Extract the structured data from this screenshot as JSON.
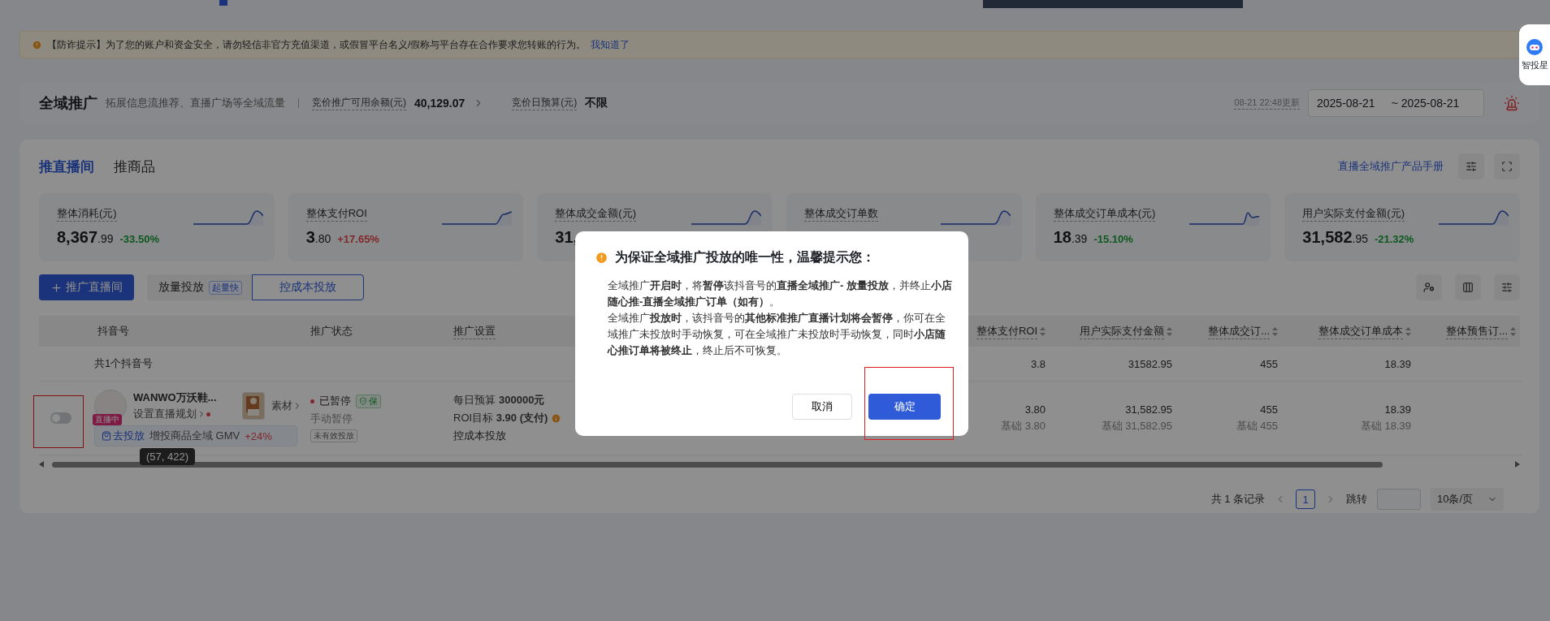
{
  "notice": {
    "text": "【防诈提示】为了您的账户和资金安全，请勿轻信非官方充值渠道，或假冒平台名义/假称与平台存在合作要求您转账的行为。",
    "link": "我知道了"
  },
  "assistant": {
    "label": "智投星"
  },
  "header": {
    "title": "全域推广",
    "subtitle": "拓展信息流推荐、直播广场等全域流量",
    "balance_label": "竞价推广可用余额(元)",
    "balance": "40,129.07",
    "budget_label": "竞价日预算(元)",
    "budget": "不限",
    "updated": "08-21 22:48更新",
    "date_start": "2025-08-21",
    "date_end": "~ 2025-08-21"
  },
  "tabs": [
    {
      "label": "推直播间",
      "selected": true
    },
    {
      "label": "推商品",
      "selected": false
    }
  ],
  "manual_link": "直播全域推广产品手册",
  "metrics": [
    {
      "label": "整体消耗(元)",
      "value": "8,367",
      "decimals": ".99",
      "change": "-33.50%",
      "kind": "fall"
    },
    {
      "label": "整体支付ROI",
      "value": "3",
      "decimals": ".80",
      "change": "+17.65%",
      "kind": "rise"
    },
    {
      "label": "整体成交金额(元)",
      "value": "31,"
    },
    {
      "label": "整体成交订单数"
    },
    {
      "label": "整体成交订单成本(元)",
      "value": "18",
      "decimals": ".39",
      "change": "-15.10%",
      "kind": "fall"
    },
    {
      "label": "用户实际支付金额(元)",
      "value": "31,582",
      "decimals": ".95",
      "change": "-21.32%",
      "kind": "fall"
    }
  ],
  "actions": {
    "add_button": "推广直播间",
    "mode_label": "放量投放",
    "mode_tag": "起量快",
    "cost_button": "控成本投放"
  },
  "table": {
    "columns": [
      {
        "label": "抖音号",
        "kind": "text"
      },
      {
        "label": "推广状态",
        "kind": "text"
      },
      {
        "label": "推广设置",
        "kind": "dashed"
      },
      {
        "label": "整体支付ROI",
        "kind": "metric"
      },
      {
        "label": "用户实际支付金额",
        "kind": "metric"
      },
      {
        "label": "整体成交订...",
        "kind": "metric"
      },
      {
        "label": "整体成交订单成本",
        "kind": "metric"
      },
      {
        "label": "整体预售订...",
        "kind": "metric"
      }
    ],
    "summary": {
      "label": "共1个抖音号",
      "values": [
        "3.8",
        "31582.95",
        "455",
        "18.39"
      ]
    },
    "rows": [
      {
        "toggle": {
          "on": false,
          "highlighted": true
        },
        "name": "WANWO万沃鞋...",
        "live_badge": "直播中",
        "plan_link": "设置直播规划",
        "material": "素材",
        "promo": {
          "action": "去投放",
          "text": "增投商品全域 GMV",
          "uplift": "+24%"
        },
        "status": {
          "label": "已暂停",
          "badge": "保",
          "reason": "手动暂停",
          "tag": "未有效投放"
        },
        "settings": {
          "budget_label": "每日预算",
          "budget": "300000元",
          "roi_label": "ROI目标",
          "roi": "3.90 (支付)",
          "mode": "控成本投放"
        },
        "metrics": [
          {
            "value": "3.80",
            "base": "基础 3.80"
          },
          {
            "value": "31,582.95",
            "base": "基础 31,582.95"
          },
          {
            "value": "455",
            "base": "基础 455"
          },
          {
            "value": "18.39",
            "base": "基础 18.39"
          }
        ]
      }
    ]
  },
  "pagination": {
    "total": "共 1 条记录",
    "pages": [
      {
        "label": "1",
        "selected": true
      }
    ],
    "jump_label": "跳转",
    "page_size": "10条/页"
  },
  "tooltip": "(57, 422)",
  "modal": {
    "title": "为保证全域推广投放的唯一性，温馨提示您：",
    "paragraphs": [
      "全域推广**开启时**，将**暂停**该抖音号的**直播全域推广- 放量投放**，并终止**小店随心推-直播全域推广订单（如有）**。",
      "全域推广**投放时**，该抖音号的**其他标准推广直播计划将会暂停**，你可在全域推广未投放时手动恢复，可在全域推广未投放时手动恢复，同时**小店随心推订单将被终止**，终止后不可恢复。"
    ],
    "cancel": "取消",
    "confirm": {
      "label": "确定",
      "highlighted": true
    }
  }
}
